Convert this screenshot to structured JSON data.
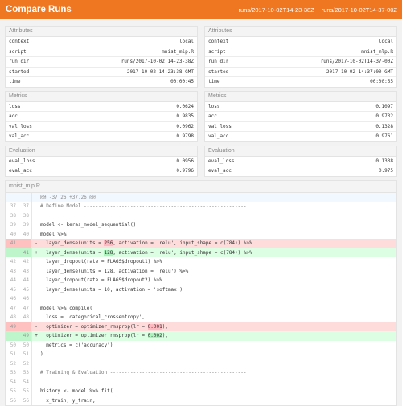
{
  "header": {
    "title": "Compare Runs",
    "run_a": "runs/2017-10-02T14-23-38Z",
    "run_b": "runs/2017-10-02T14-37-00Z"
  },
  "runs": [
    {
      "attributes_title": "Attributes",
      "attributes": [
        {
          "k": "context",
          "v": "local"
        },
        {
          "k": "script",
          "v": "mnist_mlp.R"
        },
        {
          "k": "run_dir",
          "v": "runs/2017-10-02T14-23-38Z"
        },
        {
          "k": "started",
          "v": "2017-10-02 14:23:38 GMT"
        },
        {
          "k": "time",
          "v": "00:00:45"
        }
      ],
      "metrics_title": "Metrics",
      "metrics": [
        {
          "k": "loss",
          "v": "0.0624"
        },
        {
          "k": "acc",
          "v": "0.9835"
        },
        {
          "k": "val_loss",
          "v": "0.0962"
        },
        {
          "k": "val_acc",
          "v": "0.9798"
        }
      ],
      "evaluation_title": "Evaluation",
      "evaluation": [
        {
          "k": "eval_loss",
          "v": "0.0956"
        },
        {
          "k": "eval_acc",
          "v": "0.9796"
        }
      ]
    },
    {
      "attributes_title": "Attributes",
      "attributes": [
        {
          "k": "context",
          "v": "local"
        },
        {
          "k": "script",
          "v": "mnist_mlp.R"
        },
        {
          "k": "run_dir",
          "v": "runs/2017-10-02T14-37-00Z"
        },
        {
          "k": "started",
          "v": "2017-10-02 14:37:00 GMT"
        },
        {
          "k": "time",
          "v": "00:00:55"
        }
      ],
      "metrics_title": "Metrics",
      "metrics": [
        {
          "k": "loss",
          "v": "0.1097"
        },
        {
          "k": "acc",
          "v": "0.9732"
        },
        {
          "k": "val_loss",
          "v": "0.1328"
        },
        {
          "k": "val_acc",
          "v": "0.9761"
        }
      ],
      "evaluation_title": "Evaluation",
      "evaluation": [
        {
          "k": "eval_loss",
          "v": "0.1338"
        },
        {
          "k": "eval_acc",
          "v": "0.975"
        }
      ]
    }
  ],
  "diff": {
    "filename": "mnist_mlp.R",
    "lines": [
      {
        "type": "hunk",
        "a": "",
        "b": "",
        "text": "@@ -37,26 +37,26 @@"
      },
      {
        "type": "ctx",
        "a": "37",
        "b": "37",
        "text": "# Define Model --------------------------------------------------------"
      },
      {
        "type": "ctx",
        "a": "38",
        "b": "38",
        "text": ""
      },
      {
        "type": "ctx",
        "a": "39",
        "b": "39",
        "text": "model <- keras_model_sequential()"
      },
      {
        "type": "ctx",
        "a": "40",
        "b": "40",
        "text": "model %>%"
      },
      {
        "type": "del",
        "a": "41",
        "b": "",
        "pre": "  layer_dense(units = ",
        "hl": "256",
        "post": ", activation = 'relu', input_shape = c(784)) %>%"
      },
      {
        "type": "add",
        "a": "",
        "b": "41",
        "pre": "  layer_dense(units = ",
        "hl": "128",
        "post": ", activation = 'relu', input_shape = c(784)) %>%"
      },
      {
        "type": "ctx",
        "a": "42",
        "b": "42",
        "text": "  layer_dropout(rate = FLAGS$dropout1) %>%"
      },
      {
        "type": "ctx",
        "a": "43",
        "b": "43",
        "text": "  layer_dense(units = 128, activation = 'relu') %>%"
      },
      {
        "type": "ctx",
        "a": "44",
        "b": "44",
        "text": "  layer_dropout(rate = FLAGS$dropout2) %>%"
      },
      {
        "type": "ctx",
        "a": "45",
        "b": "45",
        "text": "  layer_dense(units = 10, activation = 'softmax')"
      },
      {
        "type": "ctx",
        "a": "46",
        "b": "46",
        "text": ""
      },
      {
        "type": "ctx",
        "a": "47",
        "b": "47",
        "text": "model %>% compile("
      },
      {
        "type": "ctx",
        "a": "48",
        "b": "48",
        "text": "  loss = 'categorical_crossentropy',"
      },
      {
        "type": "del",
        "a": "49",
        "b": "",
        "pre": "  optimizer = optimizer_rmsprop(lr = ",
        "hl": "0.001",
        "post": "),"
      },
      {
        "type": "add",
        "a": "",
        "b": "49",
        "pre": "  optimizer = optimizer_rmsprop(lr = ",
        "hl": "0.002",
        "post": "),"
      },
      {
        "type": "ctx",
        "a": "50",
        "b": "50",
        "text": "  metrics = c('accuracy')"
      },
      {
        "type": "ctx",
        "a": "51",
        "b": "51",
        "text": ")"
      },
      {
        "type": "ctx",
        "a": "52",
        "b": "52",
        "text": ""
      },
      {
        "type": "ctx",
        "a": "53",
        "b": "53",
        "text": "# Training & Evaluation -----------------------------------------------"
      },
      {
        "type": "ctx",
        "a": "54",
        "b": "54",
        "text": ""
      },
      {
        "type": "ctx",
        "a": "55",
        "b": "55",
        "text": "history <- model %>% fit("
      },
      {
        "type": "ctx",
        "a": "56",
        "b": "56",
        "text": "  x_train, y_train,"
      }
    ]
  }
}
